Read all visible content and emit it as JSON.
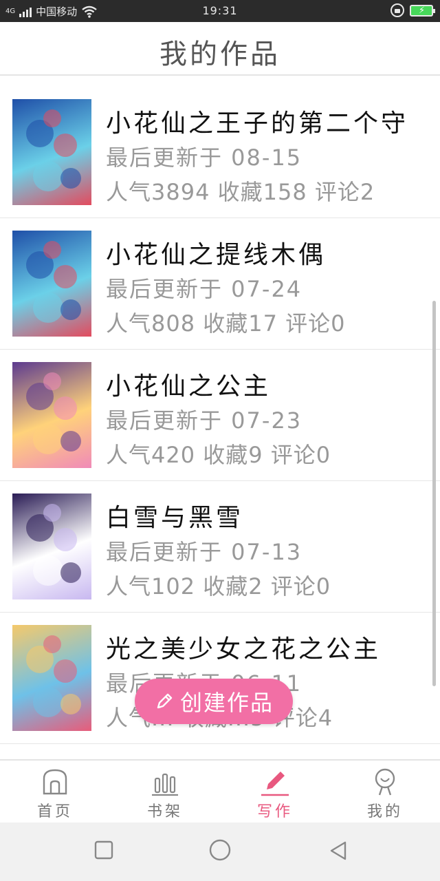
{
  "status_bar": {
    "network_label": "4G",
    "carrier": "中国移动",
    "time": "19:31"
  },
  "header": {
    "title": "我的作品"
  },
  "works": [
    {
      "title": "小花仙之王子的第二个守",
      "updated": "最后更新于 08-15",
      "stats": "人气3894 收藏158 评论2",
      "cover_colors": [
        "#1f4fa8",
        "#e34b5e",
        "#6bd0e8"
      ]
    },
    {
      "title": "小花仙之提线木偶",
      "updated": "最后更新于 07-24",
      "stats": "人气808 收藏17 评论0",
      "cover_colors": [
        "#1f4fa8",
        "#e34b5e",
        "#6bd0e8"
      ]
    },
    {
      "title": "小花仙之公主",
      "updated": "最后更新于 07-23",
      "stats": "人气420 收藏9 评论0",
      "cover_colors": [
        "#5c3a8f",
        "#f08ab8",
        "#ffd27a"
      ]
    },
    {
      "title": "白雪与黑雪",
      "updated": "最后更新于 07-13",
      "stats": "人气102 收藏2 评论0",
      "cover_colors": [
        "#2a1c55",
        "#c8b8f0",
        "#ffffff"
      ]
    },
    {
      "title": "光之美少女之花之公主",
      "updated": "最后更新于 06-11",
      "stats": "人气... 收藏...5 评论4",
      "cover_colors": [
        "#f5c96b",
        "#e85c7a",
        "#6ec1e8"
      ]
    }
  ],
  "fab": {
    "label": "创建作品",
    "icon": "pencil-icon"
  },
  "bottom_nav": [
    {
      "label": "首页",
      "icon": "home-icon",
      "active": false
    },
    {
      "label": "书架",
      "icon": "bookshelf-icon",
      "active": false
    },
    {
      "label": "写作",
      "icon": "pencil-icon",
      "active": true
    },
    {
      "label": "我的",
      "icon": "profile-icon",
      "active": false
    }
  ],
  "colors": {
    "accent": "#f26fa5",
    "active_nav": "#e8587f",
    "muted_text": "#999999"
  }
}
